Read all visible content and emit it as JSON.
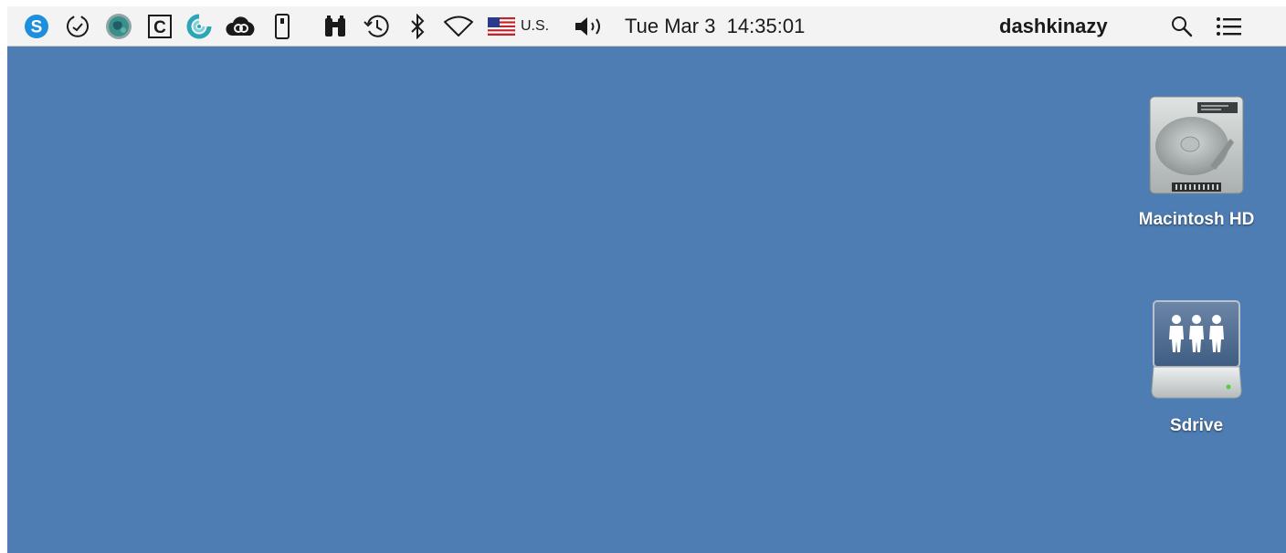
{
  "menubar": {
    "status_icons": [
      {
        "name": "skype-icon",
        "color": "#1d8fdc"
      },
      {
        "name": "tick-clock-icon"
      },
      {
        "name": "globe-app-icon",
        "color": "#3a8f8a"
      },
      {
        "name": "c-box-icon"
      },
      {
        "name": "teal-spiral-icon",
        "color": "#2aa6b8"
      },
      {
        "name": "creative-cloud-icon"
      },
      {
        "name": "phone-device-icon"
      },
      {
        "name": "binoculars-icon"
      },
      {
        "name": "time-machine-icon"
      },
      {
        "name": "bluetooth-icon"
      },
      {
        "name": "wifi-icon"
      },
      {
        "name": "us-flag-icon"
      },
      {
        "name": "volume-icon"
      },
      {
        "name": "spotlight-search-icon"
      },
      {
        "name": "notification-center-icon"
      }
    ],
    "input_source": "U.S.",
    "clock": "Tue Mar 3  14:35:01",
    "username": "dashkinazy"
  },
  "desktop": {
    "background_color": "#4e7db3",
    "icons": [
      {
        "label": "Macintosh HD",
        "icon": "hard-drive-icon"
      },
      {
        "label": "Sdrive",
        "icon": "network-share-icon"
      }
    ]
  },
  "colors": {
    "menubar_bg": "#f3f3f3",
    "desktop_bg": "#4e7db3",
    "label_text": "#ffffff"
  }
}
